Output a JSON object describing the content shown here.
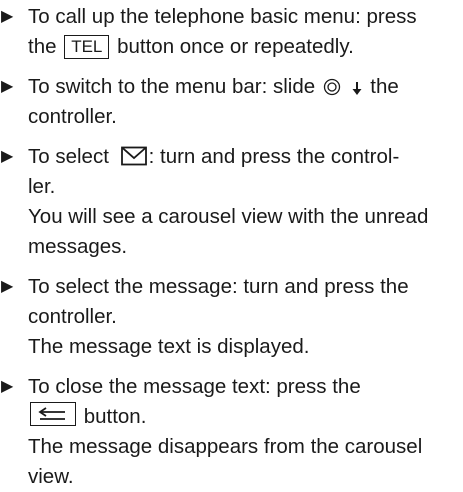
{
  "bullet_glyph": "▶",
  "icons": {
    "controller": "controller-ring-icon",
    "slide_down": "arrow-down-icon",
    "envelope": "envelope-icon",
    "back": "back-return-icon"
  },
  "steps": [
    {
      "line1_prefix": "To call up the telephone basic menu: press",
      "line2_pre": "the",
      "key_label": "TEL",
      "line2_post": "button once or repeatedly."
    },
    {
      "line1_pre": "To switch to the menu bar: slide",
      "line1_post": "the",
      "line2": "controller."
    },
    {
      "line1_pre": "To select",
      "line1_post": ": turn and press the control-",
      "line2": "ler.",
      "note_line1": "You will see a carousel view with the unread",
      "note_line2": "messages."
    },
    {
      "line1": "To select the message: turn and press the",
      "line2": "controller.",
      "note": "The message text is displayed."
    },
    {
      "line1": "To close the message text: press the",
      "line2_post": "button.",
      "note_line1": "The message disappears from the carousel",
      "note_line2": "view."
    }
  ]
}
